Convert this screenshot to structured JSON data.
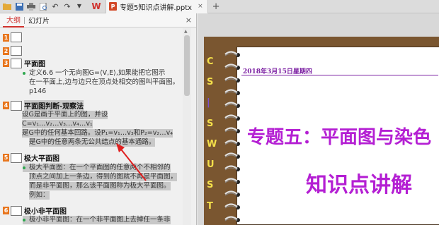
{
  "titlebar": {
    "app_logo": "W",
    "doc_icon": "P",
    "doc_title": "专题5知识点讲解.pptx",
    "close": "×",
    "new_tab": "+"
  },
  "panel": {
    "tab_outline": "大纲",
    "tab_slides": "幻灯片",
    "close": "×"
  },
  "outline": {
    "slides": [
      {
        "num": "1",
        "title": ""
      },
      {
        "num": "2",
        "title": ""
      },
      {
        "num": "3",
        "title": "平面图"
      },
      {
        "num": "4",
        "title": "平面图判断-观察法"
      },
      {
        "num": "5",
        "title": "极大平面图"
      },
      {
        "num": "6",
        "title": "极小非平面图"
      }
    ],
    "s3_lines": [
      "定义6.6  一个无向图G=⟨V,E⟩,如果能把它图示",
      "在一平面上,边与边只在顶点处相交的图叫平面图。",
      "p146"
    ],
    "s4_lines": [
      "设G是画于平面上的图，并设",
      "C=v₁…v₂…v₃…v₄…v₁",
      "是G中的任何基本回路。设P₁=v₁…v₃和P₂=v₂…v₄",
      "是G中的任意两条无公共结点的基本通路。"
    ],
    "s5_lines": [
      "极大平面图：在一个平面图的任意两个不相邻的",
      "顶点之间加上一条边，得到的图就不再是平面图，",
      "而是非平面图，那么该平面图称为极大平面图。",
      "例如："
    ],
    "s6_lines": [
      "极小非平面图：在一个非平面图上去掉任一条非"
    ]
  },
  "slide": {
    "cswust": [
      "C",
      "S",
      "|",
      "S",
      "W",
      "U",
      "S",
      "T"
    ],
    "date": "2018年3月15日星期四",
    "title": "专题五：平面图与染色",
    "subtitle": "知识点讲解"
  },
  "colors": {
    "accent": "#d0312d",
    "slide_number": "#e8761e",
    "slide_text": "#b41fd3",
    "frame": "#7a5630"
  }
}
